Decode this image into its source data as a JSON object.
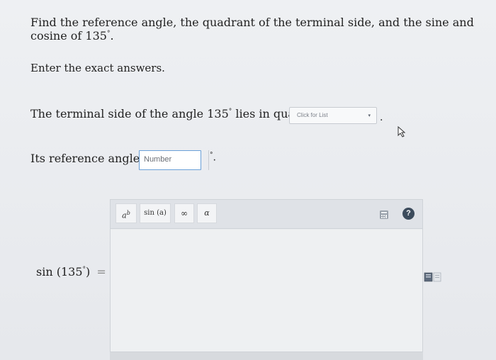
{
  "question": {
    "text": "Find the reference angle, the quadrant of the terminal side, and the sine and cosine of 135",
    "degree": "°",
    "period": "."
  },
  "instruction": "Enter the exact answers.",
  "quadrant_row": {
    "prefix": "The terminal side of the angle 135",
    "degree": "°",
    "suffix": "lies in quadrant",
    "select_placeholder": "Click for List",
    "arrow": "▾",
    "period": "."
  },
  "reference_row": {
    "prefix": "Its reference angle is",
    "input_placeholder": "Number",
    "degree": "°",
    "period": "."
  },
  "sine_row": {
    "label": "sin (135",
    "degree": "°",
    "close": ")",
    "equals": "="
  },
  "toolbar": {
    "power": {
      "base": "a",
      "exp": "b"
    },
    "sin_label": "sin (a)",
    "infinity": "∞",
    "alpha": "α",
    "help": "?"
  },
  "icons": {
    "cursor": "cursor-icon",
    "calculator": "calculator-icon",
    "help": "help-icon",
    "doc": "document-icon"
  },
  "colors": {
    "accent_border": "#6aa0d8",
    "help_bg": "#3c4b5c"
  }
}
